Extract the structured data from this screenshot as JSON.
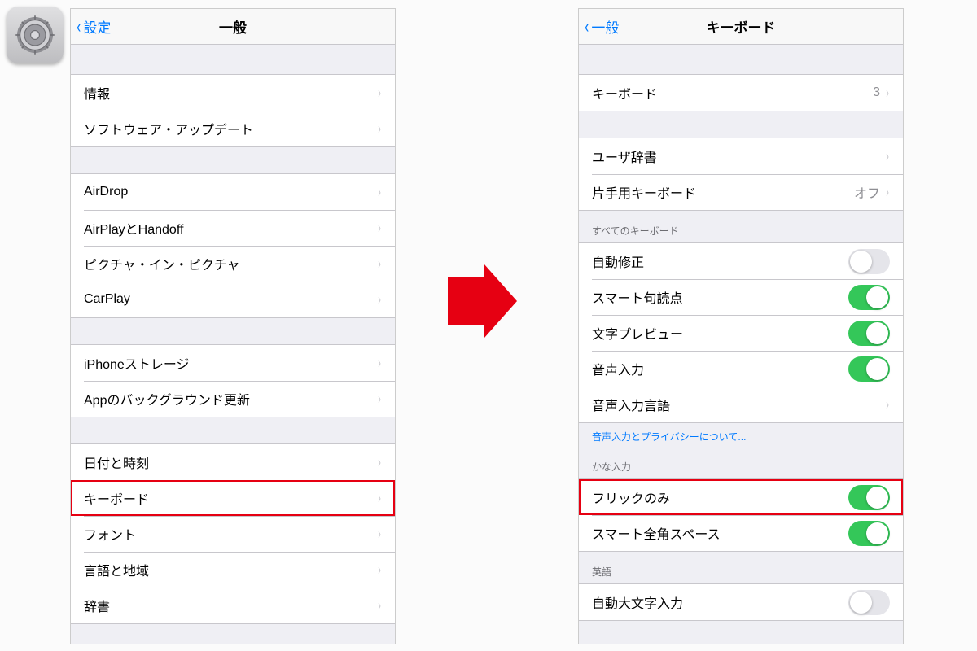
{
  "annotation": "「設定」→「一般」",
  "left_screen": {
    "nav": {
      "back": "設定",
      "title": "一般"
    },
    "groups": [
      {
        "rows": [
          {
            "label": "情報",
            "type": "disclosure"
          },
          {
            "label": "ソフトウェア・アップデート",
            "type": "disclosure"
          }
        ]
      },
      {
        "rows": [
          {
            "label": "AirDrop",
            "type": "disclosure"
          },
          {
            "label": "AirPlayとHandoff",
            "type": "disclosure"
          },
          {
            "label": "ピクチャ・イン・ピクチャ",
            "type": "disclosure"
          },
          {
            "label": "CarPlay",
            "type": "disclosure"
          }
        ]
      },
      {
        "rows": [
          {
            "label": "iPhoneストレージ",
            "type": "disclosure"
          },
          {
            "label": "Appのバックグラウンド更新",
            "type": "disclosure"
          }
        ]
      },
      {
        "rows": [
          {
            "label": "日付と時刻",
            "type": "disclosure"
          },
          {
            "label": "キーボード",
            "type": "disclosure",
            "highlight": true
          },
          {
            "label": "フォント",
            "type": "disclosure"
          },
          {
            "label": "言語と地域",
            "type": "disclosure"
          },
          {
            "label": "辞書",
            "type": "disclosure"
          }
        ]
      }
    ]
  },
  "right_screen": {
    "nav": {
      "back": "一般",
      "title": "キーボード"
    },
    "groups": [
      {
        "rows": [
          {
            "label": "キーボード",
            "type": "disclosure",
            "value": "3"
          }
        ]
      },
      {
        "rows": [
          {
            "label": "ユーザ辞書",
            "type": "disclosure"
          },
          {
            "label": "片手用キーボード",
            "type": "disclosure",
            "value": "オフ"
          }
        ]
      },
      {
        "header": "すべてのキーボード",
        "rows": [
          {
            "label": "自動修正",
            "type": "toggle",
            "on": false
          },
          {
            "label": "スマート句読点",
            "type": "toggle",
            "on": true
          },
          {
            "label": "文字プレビュー",
            "type": "toggle",
            "on": true
          },
          {
            "label": "音声入力",
            "type": "toggle",
            "on": true
          },
          {
            "label": "音声入力言語",
            "type": "disclosure"
          }
        ],
        "footer_link": "音声入力とプライバシーについて..."
      },
      {
        "header": "かな入力",
        "rows": [
          {
            "label": "フリックのみ",
            "type": "toggle",
            "on": true,
            "highlight": true
          },
          {
            "label": "スマート全角スペース",
            "type": "toggle",
            "on": true
          }
        ]
      },
      {
        "header": "英語",
        "rows": [
          {
            "label": "自動大文字入力",
            "type": "toggle",
            "on": false
          }
        ]
      }
    ]
  }
}
